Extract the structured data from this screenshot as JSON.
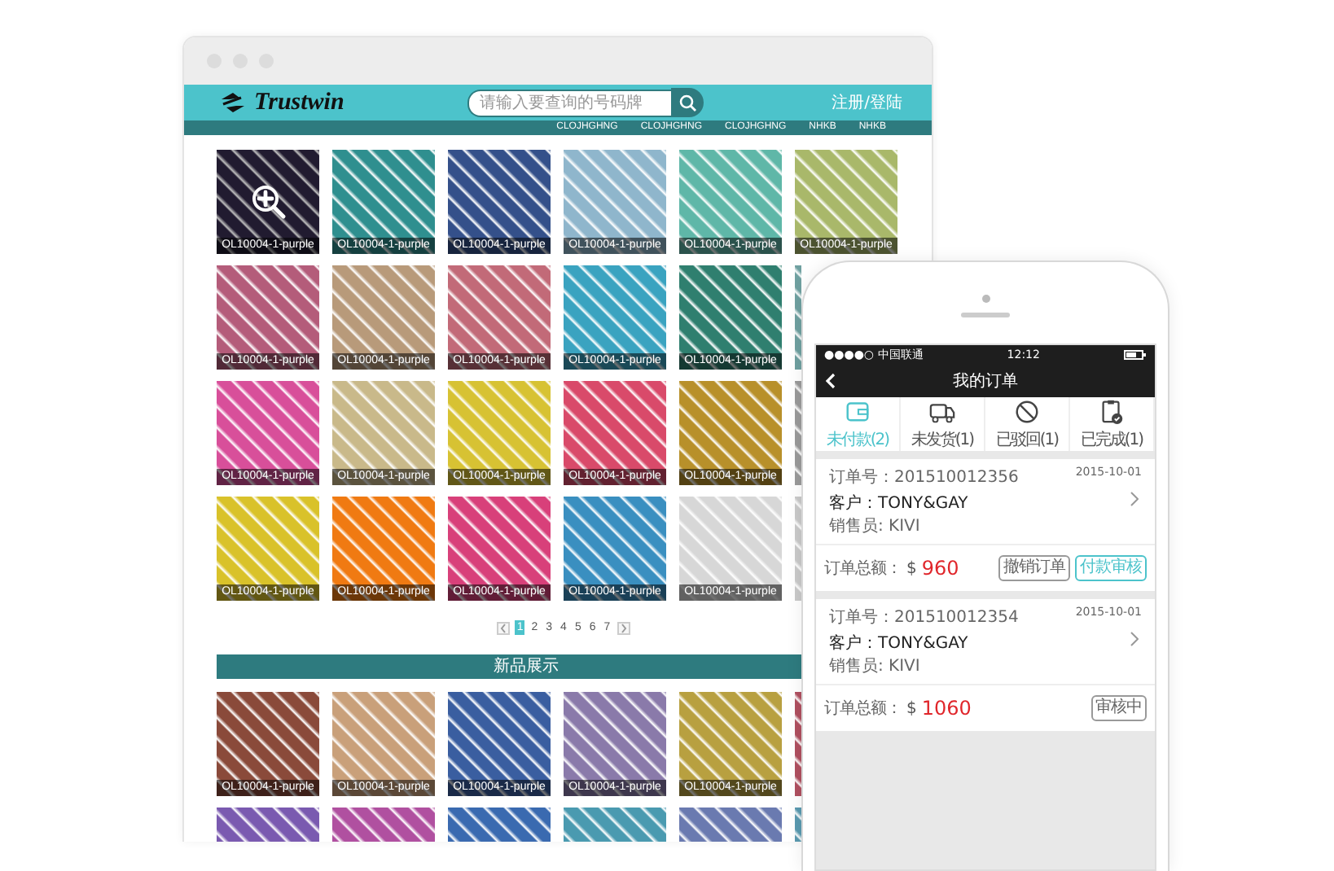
{
  "browser": {
    "logo": "Trustwin",
    "search": {
      "placeholder": "请输入要查询的号码牌"
    },
    "login_link": "注册/登陆",
    "nav": [
      "CLOJHGHNG",
      "CLOJHGHNG",
      "CLOJHGHNG",
      "NHKB",
      "NHKB"
    ],
    "products": [
      {
        "caption": "OL10004-1-purple",
        "hovered": true
      },
      {
        "caption": "OL10004-1-purple",
        "hovered": false
      },
      {
        "caption": "OL10004-1-purple",
        "hovered": false
      },
      {
        "caption": "OL10004-1-purple",
        "hovered": false
      },
      {
        "caption": "OL10004-1-purple",
        "hovered": false
      },
      {
        "caption": "OL10004-1-purple",
        "hovered": false
      },
      {
        "caption": "OL10004-1-purple",
        "hovered": false
      },
      {
        "caption": "OL10004-1-purple",
        "hovered": false
      },
      {
        "caption": "OL10004-1-purple",
        "hovered": false
      },
      {
        "caption": "OL10004-1-purple",
        "hovered": false
      },
      {
        "caption": "OL10004-1-purple",
        "hovered": false
      },
      {
        "hovered": false
      },
      {
        "caption": "OL10004-1-purple",
        "hovered": false
      },
      {
        "caption": "OL10004-1-purple",
        "hovered": false
      },
      {
        "caption": "OL10004-1-purple",
        "hovered": false
      },
      {
        "caption": "OL10004-1-purple",
        "hovered": false
      },
      {
        "caption": "OL10004-1-purple",
        "hovered": false
      },
      {
        "hovered": false
      },
      {
        "caption": "OL10004-1-purple",
        "hovered": false
      },
      {
        "caption": "OL10004-1-purple",
        "hovered": false
      },
      {
        "caption": "OL10004-1-purple",
        "hovered": false
      },
      {
        "caption": "OL10004-1-purple",
        "hovered": false
      },
      {
        "caption": "OL10004-1-purple",
        "hovered": false
      },
      {
        "hovered": false
      }
    ],
    "pages": [
      {
        "label": "1",
        "selected": true
      },
      {
        "label": "2",
        "selected": false
      },
      {
        "label": "3",
        "selected": false
      },
      {
        "label": "4",
        "selected": false
      },
      {
        "label": "5",
        "selected": false
      },
      {
        "label": "6",
        "selected": false
      },
      {
        "label": "7",
        "selected": false
      }
    ],
    "section_title": "新品展示",
    "new_products": [
      {
        "caption": "OL10004-1-purple",
        "hovered": false
      },
      {
        "caption": "OL10004-1-purple",
        "hovered": false
      },
      {
        "caption": "OL10004-1-purple",
        "hovered": false
      },
      {
        "caption": "OL10004-1-purple",
        "hovered": false
      },
      {
        "caption": "OL10004-1-purple",
        "hovered": false
      },
      {
        "hovered": false
      },
      {
        "hovered": false
      },
      {
        "hovered": false
      },
      {
        "hovered": false
      },
      {
        "hovered": false
      },
      {
        "hovered": false
      },
      {
        "hovered": false
      }
    ]
  },
  "phone": {
    "status": {
      "carrier": "●●●●○ 中国联通",
      "time": "12:12"
    },
    "title": "我的订单",
    "tabs": [
      {
        "label": "未付款(2)",
        "kind": "wallet",
        "selected": true
      },
      {
        "label": "未发货(1)",
        "kind": "truck",
        "selected": false
      },
      {
        "label": "已驳回(1)",
        "kind": "blocked",
        "selected": false
      },
      {
        "label": "已完成(1)",
        "kind": "clipboard",
        "selected": false
      }
    ],
    "orders": [
      {
        "number": "订单号：201510012356",
        "date": "2015-10-01",
        "customer": "客户：TONY&GAY",
        "seller": "销售员: KIVI",
        "total_label": "订单总额：",
        "currency": "$",
        "amount": "960",
        "actions": [
          {
            "label": "撤销订单",
            "primary": false
          },
          {
            "label": "付款审核",
            "primary": true
          }
        ]
      },
      {
        "number": "订单号：201510012354",
        "date": "2015-10-01",
        "customer": "客户：TONY&GAY",
        "seller": "销售员: KIVI",
        "total_label": "订单总额：",
        "currency": "$",
        "amount": "1060",
        "actions": [
          {
            "label": "审核中",
            "primary": false
          }
        ]
      }
    ]
  }
}
